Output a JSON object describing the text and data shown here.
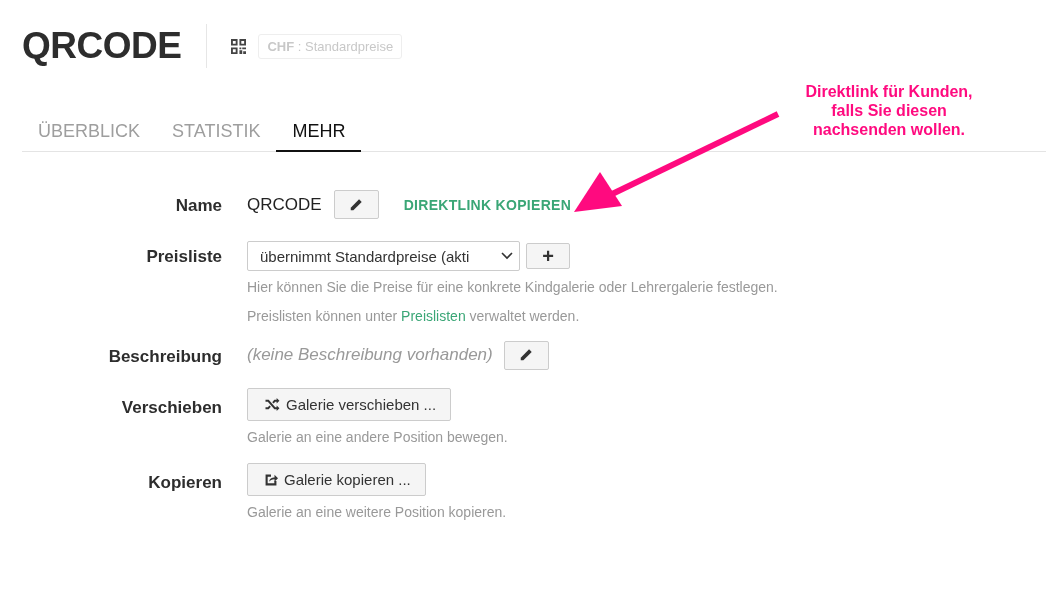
{
  "header": {
    "title": "QRCODE",
    "badge": "**CHF** : Standardpreise"
  },
  "tabs": [
    {
      "label": "ÜBERBLICK",
      "selected": false
    },
    {
      "label": "STATISTIK",
      "selected": false
    },
    {
      "label": "MEHR",
      "selected": true
    }
  ],
  "fields": [
    {
      "kind": "name",
      "label": "Name",
      "value": "QRCODE",
      "link": "DIREKTLINK KOPIEREN"
    },
    {
      "kind": "select",
      "label": "Preisliste",
      "value": "übernimmt Standardpreise (akti",
      "button": "+",
      "hint": "Hier können Sie die Preise für eine konkrete Kindgalerie oder Lehrergalerie festlegen.",
      "hint_before": "Preislisten können unter ",
      "hint_link": "Preislisten",
      "hint_after": " verwaltet werden."
    },
    {
      "kind": "description",
      "label": "Beschreibung",
      "value": "(keine Beschreibung vorhanden)"
    },
    {
      "kind": "move",
      "label": "Verschieben",
      "button": "Galerie verschieben ...",
      "hint": "Galerie an eine andere Position bewegen."
    },
    {
      "kind": "copy",
      "label": "Kopieren",
      "button": "Galerie kopieren ...",
      "hint": "Galerie an eine weitere Position kopieren."
    }
  ],
  "annotation": {
    "text": "Direktlink für Kunden, falls Sie diesen nachsenden wollen."
  }
}
